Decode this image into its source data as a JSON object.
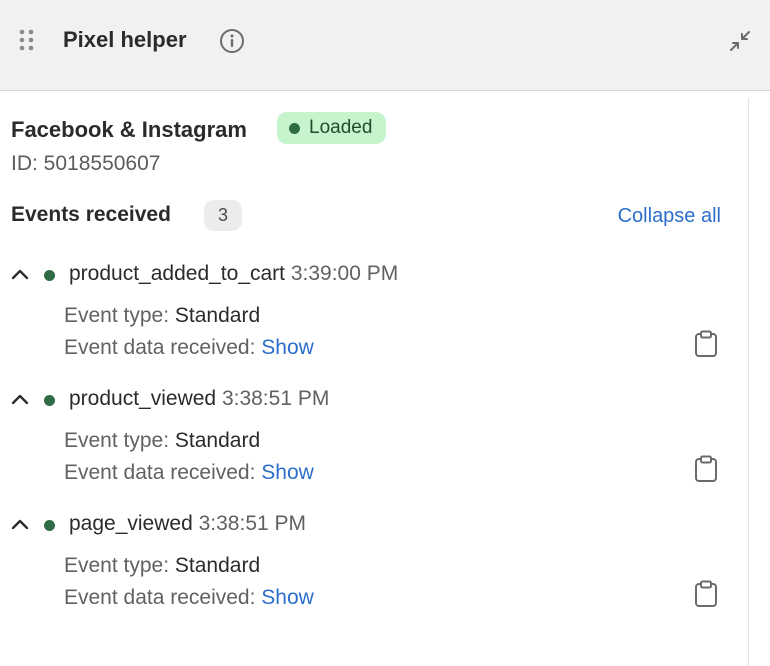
{
  "header": {
    "title": "Pixel helper",
    "icons": {
      "drag": "drag-handle-icon",
      "info": "info-icon",
      "minimize": "minimize-icon"
    }
  },
  "pixel": {
    "name": "Facebook & Instagram",
    "status": "Loaded",
    "id_label": "ID: 5018550607"
  },
  "events_section": {
    "heading": "Events received",
    "count": "3",
    "collapse_label": "Collapse all"
  },
  "events": [
    {
      "name": "product_added_to_cart",
      "time": "3:39:00 PM",
      "type_label": "Event type:",
      "type_value": "Standard",
      "data_label": "Event data received:",
      "data_link": "Show"
    },
    {
      "name": "product_viewed",
      "time": "3:38:51 PM",
      "type_label": "Event type:",
      "type_value": "Standard",
      "data_label": "Event data received:",
      "data_link": "Show"
    },
    {
      "name": "page_viewed",
      "time": "3:38:51 PM",
      "type_label": "Event type:",
      "type_value": "Standard",
      "data_label": "Event data received:",
      "data_link": "Show"
    }
  ],
  "colors": {
    "accent_link": "#2c6ecb",
    "status_bg": "#c6f4cd",
    "status_dot": "#2f6b45",
    "header_bg": "#f1f1f1"
  }
}
